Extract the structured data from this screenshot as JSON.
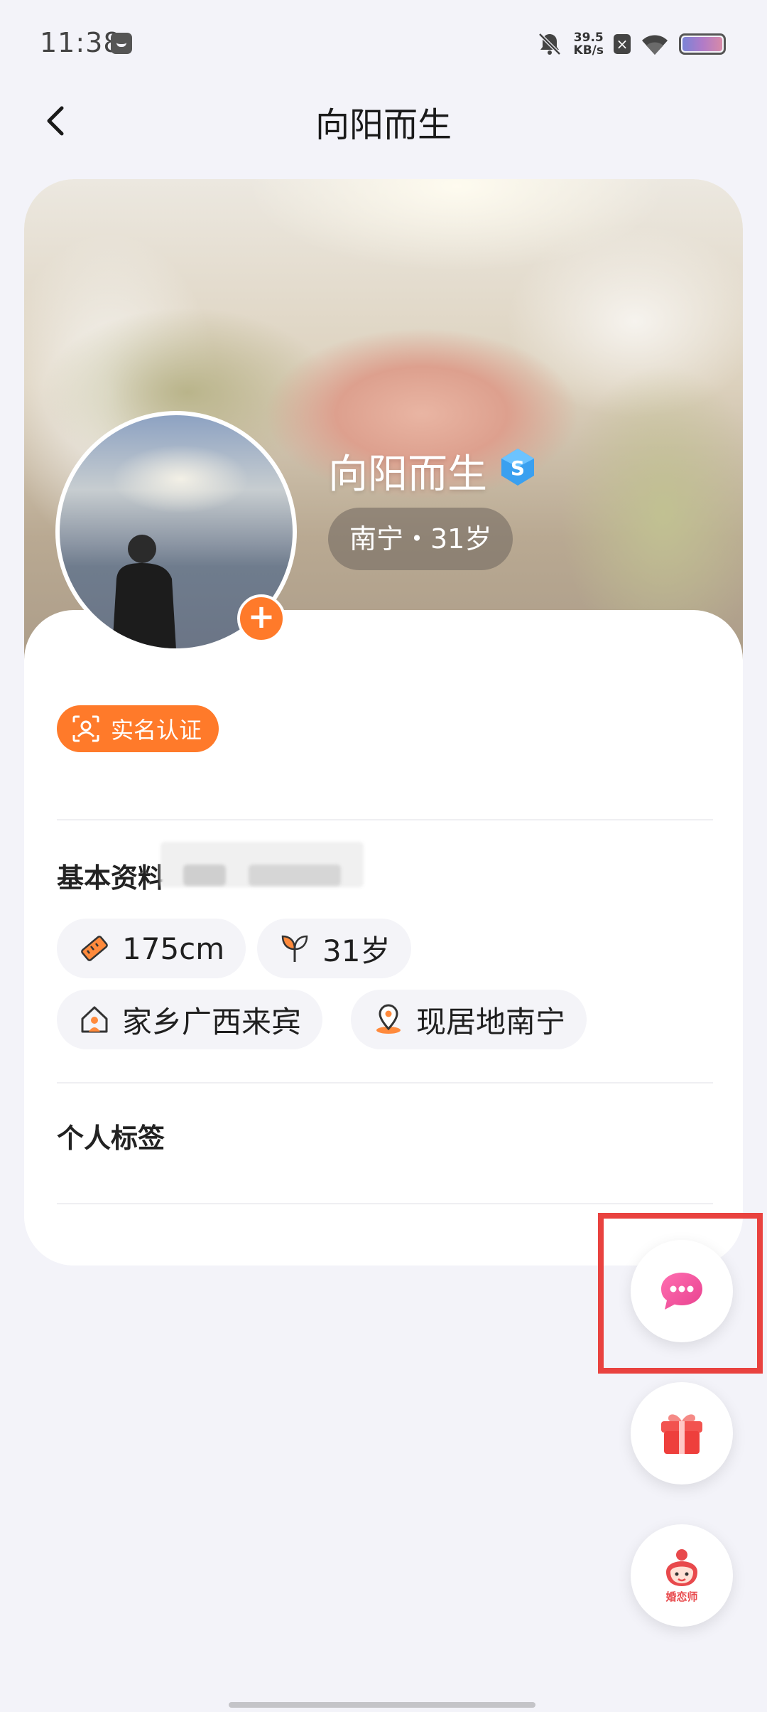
{
  "status_bar": {
    "time": "11:38",
    "net_speed_value": "39.5",
    "net_speed_unit": "KB/s"
  },
  "header": {
    "title": "向阳而生"
  },
  "profile": {
    "name": "向阳而生",
    "location_age": "南宁・31岁",
    "verify_label": "实名认证"
  },
  "basic_info": {
    "title": "基本资料",
    "chips": [
      {
        "icon": "ruler-icon",
        "label": "175cm"
      },
      {
        "icon": "sprout-icon",
        "label": "31岁"
      },
      {
        "icon": "house-icon",
        "label": "家乡广西来宾"
      },
      {
        "icon": "location-pin-icon",
        "label": "现居地南宁"
      }
    ]
  },
  "tags_section": {
    "title": "个人标签"
  },
  "floating_buttons": {
    "matchmaker_label": "婚恋师"
  },
  "colors": {
    "accent_orange": "#ff7a2a",
    "highlight_red": "#e9423f",
    "chat_pink": "#f25ba0",
    "gift_red": "#f2534f",
    "vip_blue": "#3aa0f0"
  }
}
